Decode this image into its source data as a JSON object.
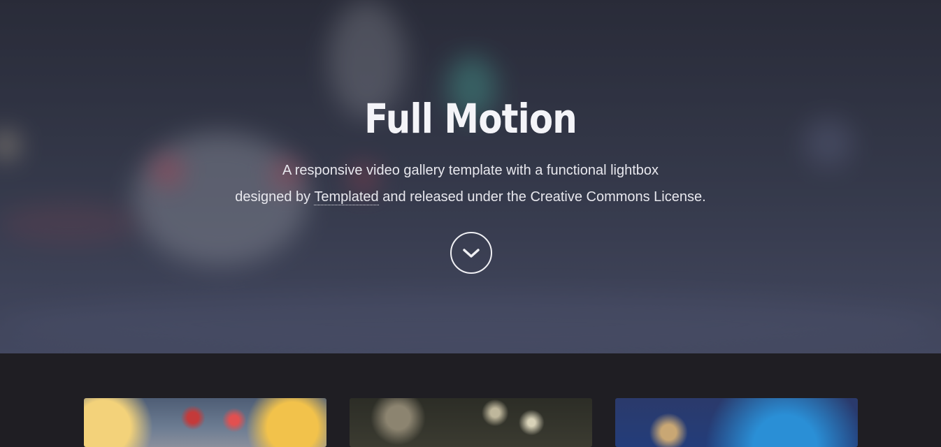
{
  "banner": {
    "title": "Full Motion",
    "line1": "A responsive video gallery template with a functional lightbox",
    "line2_prefix": "designed by ",
    "link_text": "Templated",
    "line2_suffix": " and released under the Creative Commons License.",
    "scroll_icon": "chevron-down-icon"
  },
  "colors": {
    "banner_overlay": "#3d4254",
    "main_bg": "#1f1e23",
    "text": "#f4f4f8"
  },
  "gallery": {
    "thumbnails": [
      {
        "name": "video-thumbnail-1"
      },
      {
        "name": "video-thumbnail-2"
      },
      {
        "name": "video-thumbnail-3"
      }
    ]
  }
}
